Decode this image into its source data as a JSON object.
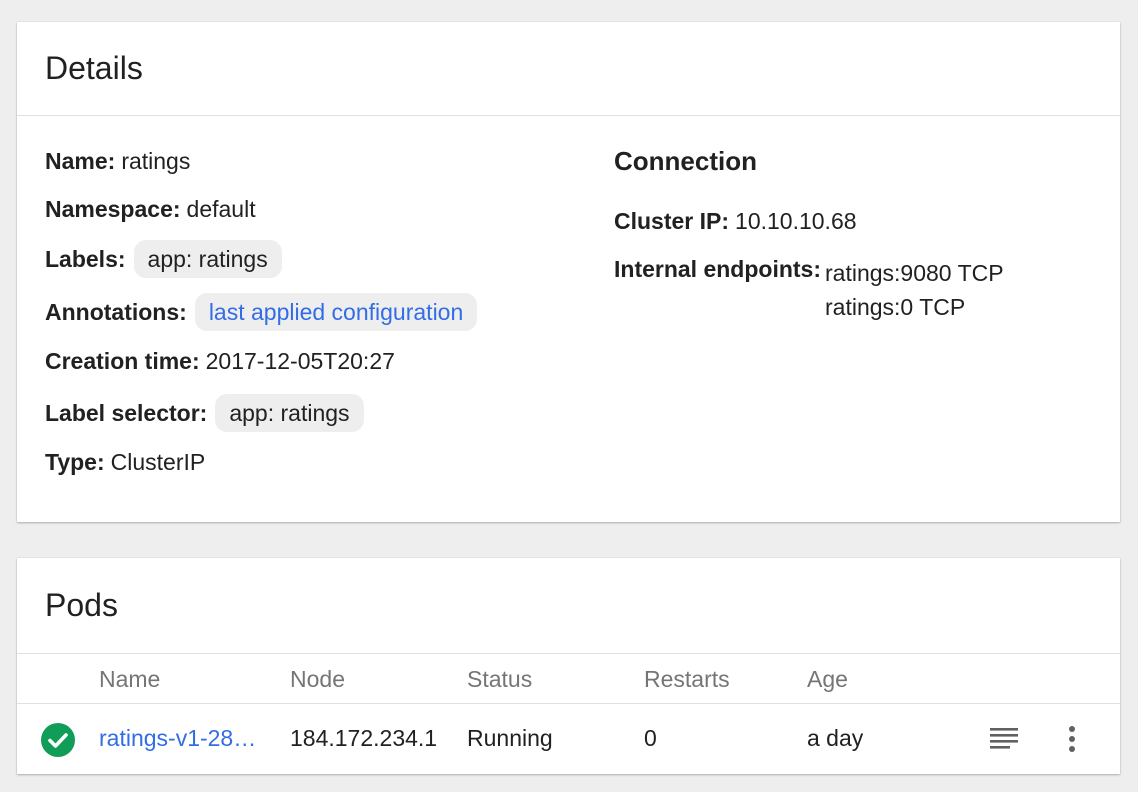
{
  "details": {
    "title": "Details",
    "name": {
      "key": "Name:",
      "value": "ratings"
    },
    "namespace": {
      "key": "Namespace:",
      "value": "default"
    },
    "labels": {
      "key": "Labels:",
      "chip": "app: ratings"
    },
    "annotations": {
      "key": "Annotations:",
      "link": "last applied configuration"
    },
    "creation_time": {
      "key": "Creation time:",
      "value": "2017-12-05T20:27"
    },
    "label_selector": {
      "key": "Label selector:",
      "chip": "app: ratings"
    },
    "type": {
      "key": "Type:",
      "value": "ClusterIP"
    }
  },
  "connection": {
    "title": "Connection",
    "cluster_ip": {
      "key": "Cluster IP:",
      "value": "10.10.10.68"
    },
    "internal_endpoints": {
      "key": "Internal endpoints:",
      "values": [
        "ratings:9080 TCP",
        "ratings:0 TCP"
      ]
    }
  },
  "pods": {
    "title": "Pods",
    "columns": [
      "Name",
      "Node",
      "Status",
      "Restarts",
      "Age"
    ],
    "rows": [
      {
        "name": "ratings-v1-28…",
        "node": "184.172.234.1",
        "status": "Running",
        "restarts": "0",
        "age": "a day"
      }
    ]
  },
  "colors": {
    "link": "#326de6",
    "success": "#0f9d58",
    "chip_bg": "#eeeeee"
  }
}
